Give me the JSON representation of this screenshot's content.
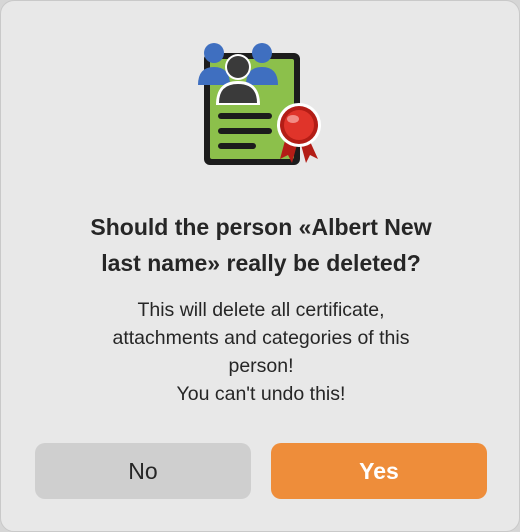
{
  "dialog": {
    "icon": "person-certificate-icon",
    "title_line1": "Should the person «Albert New",
    "title_line2": "last name» really be deleted?",
    "message_lines": [
      "This will delete all certificate,",
      "attachments and categories of this",
      "person!",
      "You can't undo this!"
    ],
    "no_label": "No",
    "yes_label": "Yes",
    "colors": {
      "background": "#e8e8e8",
      "no_button": "#cfcfcf",
      "yes_button": "#ee8d3a",
      "certificate_green": "#8cc04b",
      "people_blue": "#3f6fc0",
      "seal_red": "#d8261c"
    }
  }
}
